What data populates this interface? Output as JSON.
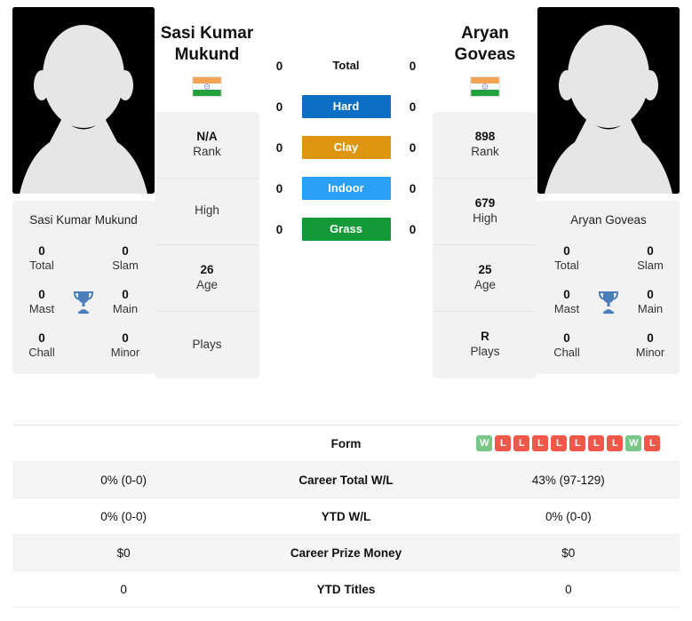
{
  "players": {
    "left": {
      "display_name_line1": "Sasi Kumar",
      "display_name_line2": "Mukund",
      "card_name": "Sasi Kumar Mukund",
      "flag": "india-flag-icon",
      "avatar": "player-avatar-placeholder",
      "titles": [
        {
          "value": "0",
          "label": "Total"
        },
        {
          "value": "0",
          "label": "Slam"
        },
        {
          "value": "0",
          "label": "Mast"
        },
        {
          "value": "0",
          "label": "Main"
        },
        {
          "value": "0",
          "label": "Chall"
        },
        {
          "value": "0",
          "label": "Minor"
        }
      ],
      "info": [
        {
          "value": "N/A",
          "label": "Rank"
        },
        {
          "value": "",
          "label": "High"
        },
        {
          "value": "26",
          "label": "Age"
        },
        {
          "value": "",
          "label": "Plays"
        }
      ]
    },
    "right": {
      "display_name_line1": "Aryan",
      "display_name_line2": "Goveas",
      "card_name": "Aryan Goveas",
      "flag": "india-flag-icon",
      "avatar": "player-avatar-placeholder",
      "titles": [
        {
          "value": "0",
          "label": "Total"
        },
        {
          "value": "0",
          "label": "Slam"
        },
        {
          "value": "0",
          "label": "Mast"
        },
        {
          "value": "0",
          "label": "Main"
        },
        {
          "value": "0",
          "label": "Chall"
        },
        {
          "value": "0",
          "label": "Minor"
        }
      ],
      "info": [
        {
          "value": "898",
          "label": "Rank"
        },
        {
          "value": "679",
          "label": "High"
        },
        {
          "value": "25",
          "label": "Age"
        },
        {
          "value": "R",
          "label": "Plays"
        }
      ]
    }
  },
  "head_to_head": [
    {
      "left": "0",
      "label": "Total",
      "right": "0",
      "color": ""
    },
    {
      "left": "0",
      "label": "Hard",
      "right": "0",
      "color": "#0d6fc4"
    },
    {
      "left": "0",
      "label": "Clay",
      "right": "0",
      "color": "#de9511"
    },
    {
      "left": "0",
      "label": "Indoor",
      "right": "0",
      "color": "#29a0f5"
    },
    {
      "left": "0",
      "label": "Grass",
      "right": "0",
      "color": "#149939"
    }
  ],
  "stats_table": {
    "rows": [
      {
        "left": "",
        "label": "Form",
        "right": ""
      },
      {
        "left": "0% (0-0)",
        "label": "Career Total W/L",
        "right": "43% (97-129)"
      },
      {
        "left": "0% (0-0)",
        "label": "YTD W/L",
        "right": "0% (0-0)"
      },
      {
        "left": "$0",
        "label": "Career Prize Money",
        "right": "$0"
      },
      {
        "left": "0",
        "label": "YTD Titles",
        "right": "0"
      }
    ],
    "form": [
      "W",
      "L",
      "L",
      "L",
      "L",
      "L",
      "L",
      "L",
      "W",
      "L"
    ]
  },
  "colors": {
    "win": "#78c68a",
    "loss": "#f0584a",
    "card_bg": "#f2f2f2",
    "row_alt": "#f5f5f5",
    "trophy": "#4a7ebb"
  },
  "icons": {
    "trophy": "trophy-icon"
  }
}
